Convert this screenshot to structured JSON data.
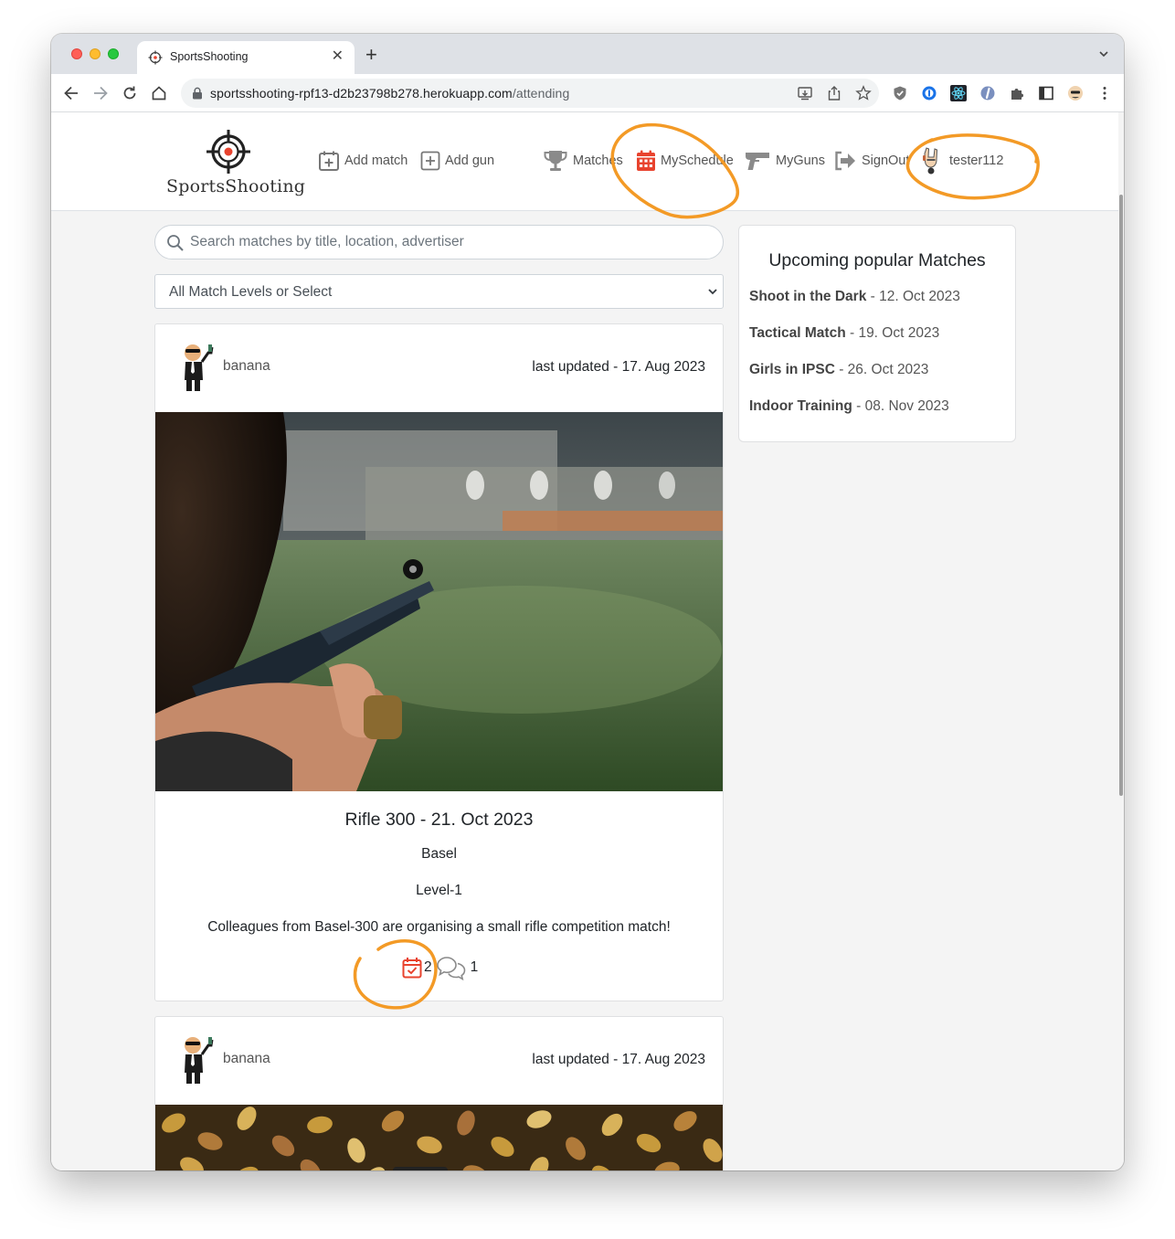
{
  "browser": {
    "tab_title": "SportsShooting",
    "url_host": "sportsshooting-rpf13-d2b23798b278.herokuapp.com",
    "url_path": "/attending"
  },
  "nav": {
    "brand": "SportsShooting",
    "add_match": "Add match",
    "add_gun": "Add gun",
    "matches": "Matches",
    "my_schedule": "MySchedule",
    "my_guns": "MyGuns",
    "sign_out": "SignOut",
    "username": "tester112"
  },
  "search": {
    "placeholder": "Search matches by title, location, advertiser"
  },
  "filter": {
    "selected": "All Match Levels or Select"
  },
  "cards": [
    {
      "author": "banana",
      "updated": "last updated - 17. Aug 2023",
      "title": "Rifle 300 - 21. Oct 2023",
      "location": "Basel",
      "level": "Level-1",
      "description": "Colleagues from Basel-300 are organising a small rifle competition match!",
      "attending_count": "2",
      "comment_count": "1"
    },
    {
      "author": "banana",
      "updated": "last updated - 17. Aug 2023"
    }
  ],
  "popular": {
    "title": "Upcoming popular Matches",
    "items": [
      {
        "name": "Shoot in the Dark",
        "date": " - 12. Oct 2023"
      },
      {
        "name": "Tactical Match",
        "date": " - 19. Oct 2023"
      },
      {
        "name": "Girls in IPSC",
        "date": " - 26. Oct 2023"
      },
      {
        "name": "Indoor Training",
        "date": " - 08. Nov 2023"
      }
    ]
  },
  "colors": {
    "accent_red": "#e8432e",
    "annotation_orange": "#f39a26",
    "icon_gray": "#8a8a8a"
  }
}
